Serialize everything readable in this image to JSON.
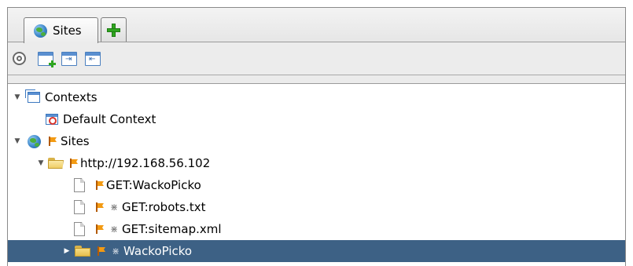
{
  "tabs": {
    "sites_label": "Sites"
  },
  "icons": {
    "tab_sites": "globe-icon",
    "tab_add": "plus-icon",
    "toolbar": [
      "target-icon",
      "new-context-icon",
      "import-context-icon",
      "export-context-icon"
    ]
  },
  "tree": {
    "contexts_label": "Contexts",
    "default_context_label": "Default Context",
    "sites_label": "Sites",
    "host_label": "http://192.168.56.102",
    "node_wackopicko_get": "GET:WackoPicko",
    "node_robots": "GET:robots.txt",
    "node_sitemap": "GET:sitemap.xml",
    "node_wackopicko_folder": "WackoPicko"
  },
  "colors": {
    "selection": "#3d6185",
    "flag": "#f39a12",
    "add_green": "#2fa51f"
  }
}
